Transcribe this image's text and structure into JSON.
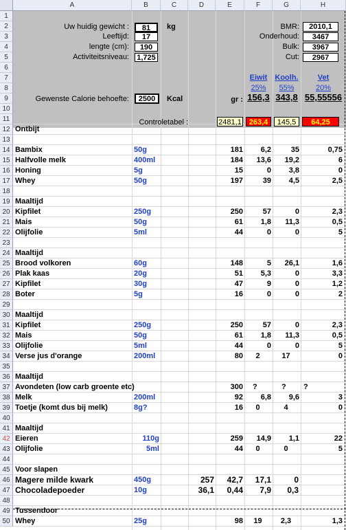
{
  "columns": [
    "A",
    "B",
    "C",
    "D",
    "E",
    "F",
    "G",
    "H"
  ],
  "rows": [
    "1",
    "2",
    "3",
    "4",
    "5",
    "6",
    "7",
    "8",
    "9",
    "10",
    "11",
    "12",
    "13",
    "14",
    "15",
    "16",
    "17",
    "18",
    "19",
    "20",
    "21",
    "22",
    "23",
    "24",
    "25",
    "26",
    "27",
    "28",
    "29",
    "30",
    "31",
    "32",
    "33",
    "34",
    "35",
    "36",
    "37",
    "38",
    "39",
    "40",
    "41",
    "42",
    "43",
    "44",
    "45",
    "46",
    "47",
    "48",
    "49",
    "50"
  ],
  "selected_row": "42",
  "inputs": {
    "weight_label": "Uw huidig gewicht :",
    "weight_value": "81",
    "weight_unit": "kg",
    "age_label": "Leeftijd:",
    "age_value": "17",
    "length_label": "lengte (cm):",
    "length_value": "190",
    "activity_label": "Activiteitsniveau:",
    "activity_value": "1,725",
    "desired_label": "Gewenste Calorie behoefte:",
    "desired_value": "2500",
    "desired_unit": "Kcal"
  },
  "results": {
    "bmr_label": "BMR:",
    "bmr_value": "2010,1",
    "onderhoud_label": "Onderhoud:",
    "onderhoud_value": "3467",
    "bulk_label": "Bulk:",
    "bulk_value": "3967",
    "cut_label": "Cut:",
    "cut_value": "2967"
  },
  "macros": {
    "eiwit_label": "Eiwit",
    "eiwit_pct": "25%",
    "eiwit_gr": "156,3",
    "koolh_label": "Koolh.",
    "koolh_pct": "55%",
    "koolh_gr": "343,8",
    "vet_label": "Vet",
    "vet_pct": "20%",
    "vet_gr": "55,55556",
    "gr_label": "gr :"
  },
  "control": {
    "label": "Controletabel :",
    "values": [
      "2481,1",
      "263,4",
      "145,5",
      "64,25"
    ],
    "colors": [
      "#ffffcc",
      "#ff0000",
      "#ffffcc",
      "#ff0000"
    ],
    "text_colors": [
      "#000000",
      "#ffff00",
      "#000000",
      "#ffff00"
    ]
  },
  "lines": [
    {
      "row": "12",
      "a": "Ontbijt",
      "section": true
    },
    {
      "row": "14",
      "a": "Bambix",
      "b": "50g",
      "e": "181",
      "f": "6,2",
      "g": "35",
      "h": "0,75"
    },
    {
      "row": "15",
      "a": "Halfvolle melk",
      "b": "400ml",
      "e": "184",
      "f": "13,6",
      "g": "19,2",
      "h": "6"
    },
    {
      "row": "16",
      "a": "Honing",
      "b": "5g",
      "e": "15",
      "f": "0",
      "g": "3,8",
      "h": "0"
    },
    {
      "row": "17",
      "a": "Whey",
      "b": "50g",
      "e": "197",
      "f": "39",
      "g": "4,5",
      "h": "2,5"
    },
    {
      "row": "19",
      "a": "Maaltijd",
      "section": true
    },
    {
      "row": "20",
      "a": "Kipfilet",
      "b": "250g",
      "e": "250",
      "f": "57",
      "g": "0",
      "h": "2,3"
    },
    {
      "row": "21",
      "a": "Mais",
      "b": "50g",
      "e": "61",
      "f": "1,8",
      "g": "11,3",
      "h": "0,5"
    },
    {
      "row": "22",
      "a": "Olijfolie",
      "b": "5ml",
      "e": "44",
      "f": "0",
      "g": "0",
      "h": "5"
    },
    {
      "row": "24",
      "a": "Maaltijd",
      "section": true
    },
    {
      "row": "25",
      "a": "Brood volkoren",
      "b": "60g",
      "e": "148",
      "f": "5",
      "g": "26,1",
      "h": "1,6"
    },
    {
      "row": "26",
      "a": "Plak kaas",
      "b": "20g",
      "e": "51",
      "f": "5,3",
      "g": "0",
      "h": "3,3"
    },
    {
      "row": "27",
      "a": "Kipfilet",
      "b": "30g",
      "e": "47",
      "f": "9",
      "g": "0",
      "h": "1,2"
    },
    {
      "row": "28",
      "a": "Boter",
      "b": "5g",
      "e": "16",
      "f": "0",
      "g": "0",
      "h": "2"
    },
    {
      "row": "30",
      "a": "Maaltijd",
      "section": true
    },
    {
      "row": "31",
      "a": "Kipfilet",
      "b": "250g",
      "e": "250",
      "f": "57",
      "g": "0",
      "h": "2,3"
    },
    {
      "row": "32",
      "a": "Mais",
      "b": "50g",
      "e": "61",
      "f": "1,8",
      "g": "11,3",
      "h": "0,5"
    },
    {
      "row": "33",
      "a": "Olijfolie",
      "b": "5ml",
      "e": "44",
      "f": "0",
      "g": "0",
      "h": "5"
    },
    {
      "row": "34",
      "a": "Verse jus d'orange",
      "b": "200ml",
      "e": "80",
      "f": "2",
      "g": "17",
      "h": "0",
      "centerfg": true
    },
    {
      "row": "36",
      "a": "Maaltijd",
      "section": true
    },
    {
      "row": "37",
      "a": "Avondeten (low carb groente etc)",
      "e": "300",
      "f": "?",
      "g": "?",
      "h": "?",
      "qmarks": true
    },
    {
      "row": "38",
      "a": "Melk",
      "b": "200ml",
      "e": "92",
      "f": "6,8",
      "g": "9,6",
      "h": "3"
    },
    {
      "row": "39",
      "a": "Toetje (komt dus bij melk)",
      "b": "8g?",
      "e": "16",
      "f": "0",
      "g": "4",
      "h": "0",
      "centerfg": true
    },
    {
      "row": "41",
      "a": "Maaltijd",
      "section": true
    },
    {
      "row": "42",
      "a": "Eieren",
      "b": "110g",
      "e": "259",
      "f": "14,9",
      "g": "1,1",
      "h": "22",
      "bright": true
    },
    {
      "row": "43",
      "a": "Olijfolie",
      "b": "5ml",
      "e": "44",
      "f": "0",
      "g": "0",
      "h": "5",
      "bright": true,
      "centerfg": true
    },
    {
      "row": "45",
      "a": "Voor slapen",
      "section": true
    },
    {
      "row": "46",
      "a": "Magere milde kwark",
      "b": "450g",
      "d": "257",
      "e": "42,7",
      "f": "17,1",
      "g": "0",
      "shifted": true
    },
    {
      "row": "47",
      "a": "Chocoladepoeder",
      "b": "10g",
      "d": "36,1",
      "e": "0,44",
      "f": "7,9",
      "g": "0,3",
      "shifted": true
    },
    {
      "row": "49",
      "a": "Tussendoor",
      "section": true
    },
    {
      "row": "50",
      "a": "Whey",
      "b": "25g",
      "e": "98",
      "f": "19",
      "g": "2,3",
      "h": "1,3",
      "centerfg": true
    }
  ]
}
